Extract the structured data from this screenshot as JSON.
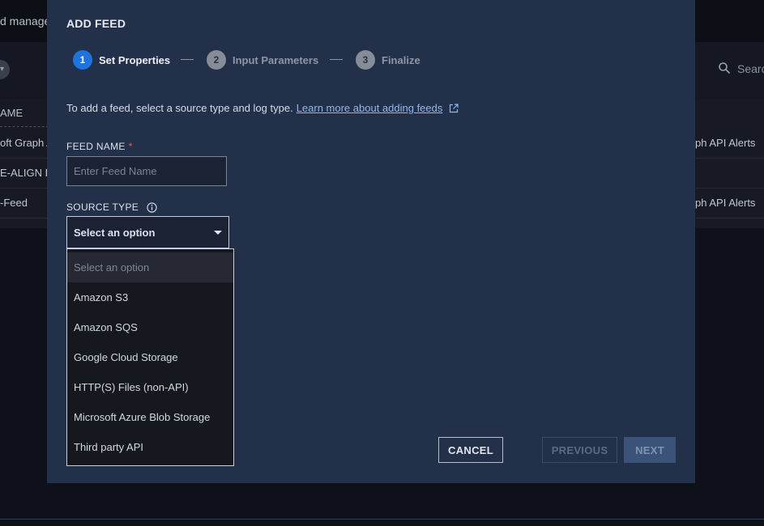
{
  "background": {
    "page_title": "d manage",
    "search_placeholder": "Searc",
    "table": {
      "column_header": "AME",
      "rows": [
        {
          "name": "oft Graph A",
          "type": "ph API Alerts"
        },
        {
          "name": "E-ALIGN En",
          "type": ""
        },
        {
          "name": "-Feed",
          "type": "ph API Alerts"
        }
      ]
    }
  },
  "modal": {
    "title": "ADD FEED",
    "steps": [
      {
        "number": "1",
        "label": "Set Properties",
        "active": true
      },
      {
        "number": "2",
        "label": "Input Parameters",
        "active": false
      },
      {
        "number": "3",
        "label": "Finalize",
        "active": false
      }
    ],
    "intro_text": "To add a feed, select a source type and log type.",
    "intro_link": "Learn more about adding feeds",
    "feed_name": {
      "label": "FEED NAME",
      "required_marker": "*",
      "placeholder": "Enter Feed Name",
      "value": ""
    },
    "source_type": {
      "label": "SOURCE TYPE",
      "selected": "Select an option",
      "options": [
        "Select an option",
        "Amazon S3",
        "Amazon SQS",
        "Google Cloud Storage",
        "HTTP(S) Files (non-API)",
        "Microsoft Azure Blob Storage",
        "Third party API"
      ]
    },
    "buttons": {
      "cancel": "CANCEL",
      "previous": "PREVIOUS",
      "next": "NEXT"
    }
  },
  "colors": {
    "modal_bg": "#23304a",
    "accent_blue": "#1f73e0",
    "link": "#8fb7ec",
    "required": "#e05c6a"
  },
  "icons": [
    "chevron-down-icon",
    "search-icon",
    "external-link-icon",
    "info-icon",
    "caret-down-icon"
  ]
}
